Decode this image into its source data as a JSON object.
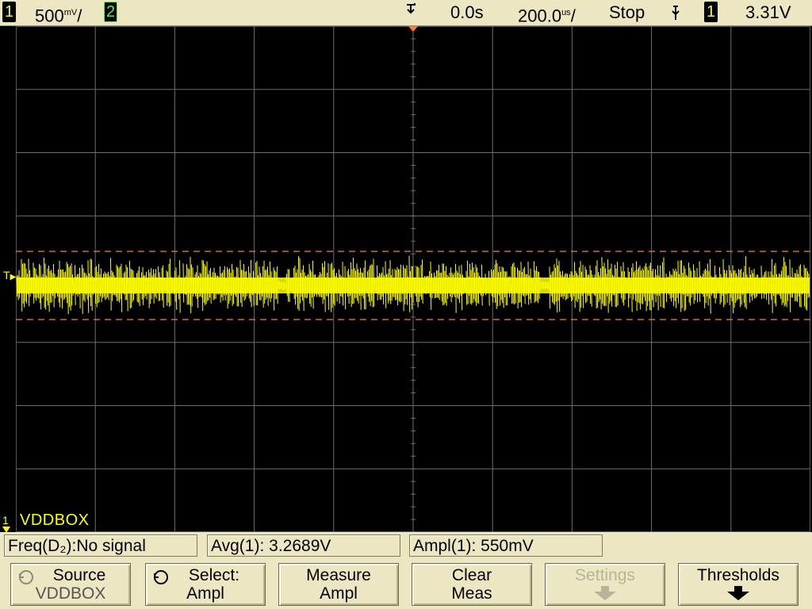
{
  "status_bar": {
    "ch1_number": "1",
    "ch1_scale_value": "500",
    "ch1_scale_units": "mV",
    "ch2_number": "2",
    "time_offset": "0.0s",
    "time_scale_value": "200.0",
    "time_scale_units": "us",
    "run_state": "Stop",
    "trigger_slope_icon": "falling-edge-icon",
    "trigger_source": "1",
    "trigger_level": "3.31V"
  },
  "screen": {
    "ch1_label": "VDDBOX",
    "ground_marker": "1",
    "trigger_level_marker": "T",
    "trace_color": "#ffff00",
    "grid_color": "#6e6e6e",
    "cursor_color": "#ff7a33"
  },
  "measurements": [
    {
      "label": "Freq(D₂):No signal"
    },
    {
      "label": "Avg(1): 3.2689V"
    },
    {
      "label": "Ampl(1): 550mV"
    }
  ],
  "softkeys": [
    {
      "line1": "Source",
      "line2": "VDDBOX",
      "icon": "rotary-knob-icon",
      "enabled": true
    },
    {
      "line1": "Select:",
      "line2": "Ampl",
      "icon": "rotary-knob-icon",
      "enabled": true
    },
    {
      "line1": "Measure",
      "line2": "Ampl",
      "enabled": true
    },
    {
      "line1": "Clear",
      "line2": "Meas",
      "enabled": true
    },
    {
      "line1": "Settings",
      "line2": "",
      "icon": "down-arrow-icon",
      "enabled": false
    },
    {
      "line1": "Thresholds",
      "line2": "",
      "icon": "down-arrow-icon",
      "enabled": true
    }
  ]
}
